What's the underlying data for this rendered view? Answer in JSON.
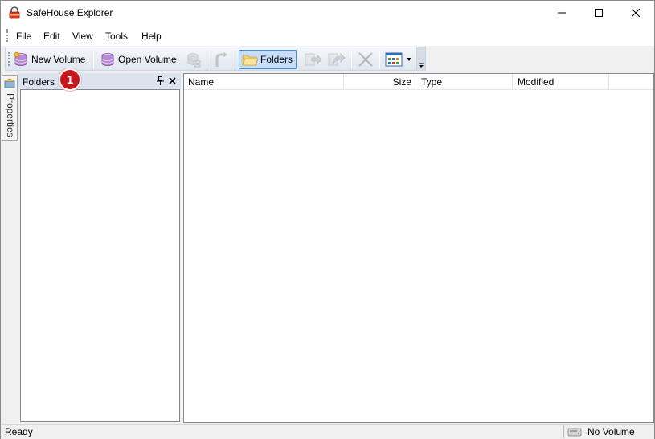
{
  "window": {
    "title": "SafeHouse Explorer",
    "icons": {
      "app": "padlock-app-icon",
      "minimize": "minimize-icon",
      "maximize": "maximize-icon",
      "close": "close-icon"
    }
  },
  "menu": {
    "items": [
      "File",
      "Edit",
      "View",
      "Tools",
      "Help"
    ]
  },
  "toolbar": {
    "new_volume": "New Volume",
    "open_volume": "Open Volume",
    "folders": "Folders",
    "icons": [
      "new-volume-icon",
      "open-volume-icon",
      "close-volume-icon",
      "up-icon",
      "folders-icon",
      "copy-to-icon",
      "move-to-icon",
      "delete-icon",
      "view-mode-icon"
    ]
  },
  "sidebar": {
    "properties_tab": "Properties"
  },
  "folders_panel": {
    "title": "Folders",
    "pin_glyph": "⌷",
    "close_glyph": "✕"
  },
  "annotation": {
    "badge": "1",
    "color": "#c4161c"
  },
  "file_list": {
    "columns": [
      "Name",
      "Size",
      "Type",
      "Modified"
    ]
  },
  "status": {
    "text": "Ready",
    "volume": "No Volume"
  },
  "colors": {
    "accent": "#3d8ee0",
    "selected_button": "#c6defa",
    "panel_header": "#dbe3ee"
  }
}
